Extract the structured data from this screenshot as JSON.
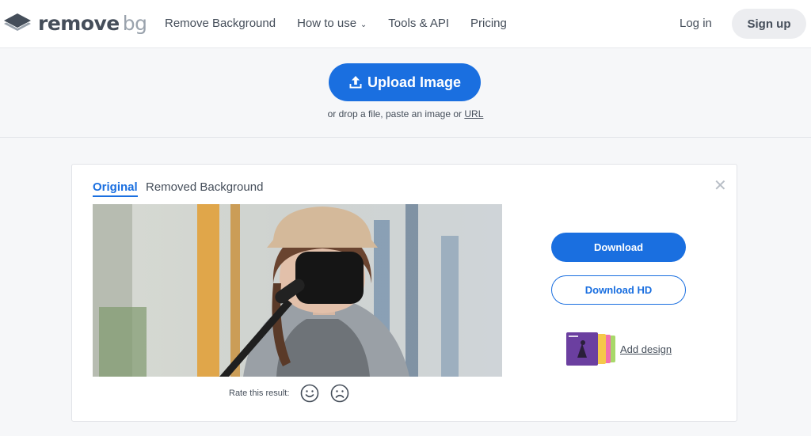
{
  "header": {
    "logo_main": "remove",
    "logo_suffix": "bg",
    "nav": [
      "Remove Background",
      "How to use",
      "Tools & API",
      "Pricing"
    ],
    "login": "Log in",
    "signup": "Sign up"
  },
  "upload": {
    "button_label": "Upload Image",
    "drop_text": "or drop a file, paste an image or",
    "url_link": "URL"
  },
  "result": {
    "tabs": [
      "Original",
      "Removed Background"
    ],
    "active_tab": "Original",
    "rate_label": "Rate this result:",
    "download": "Download",
    "download_hd": "Download HD",
    "add_design": "Add design"
  },
  "colors": {
    "accent": "#1a6fe0",
    "background": "#f6f7f9"
  }
}
